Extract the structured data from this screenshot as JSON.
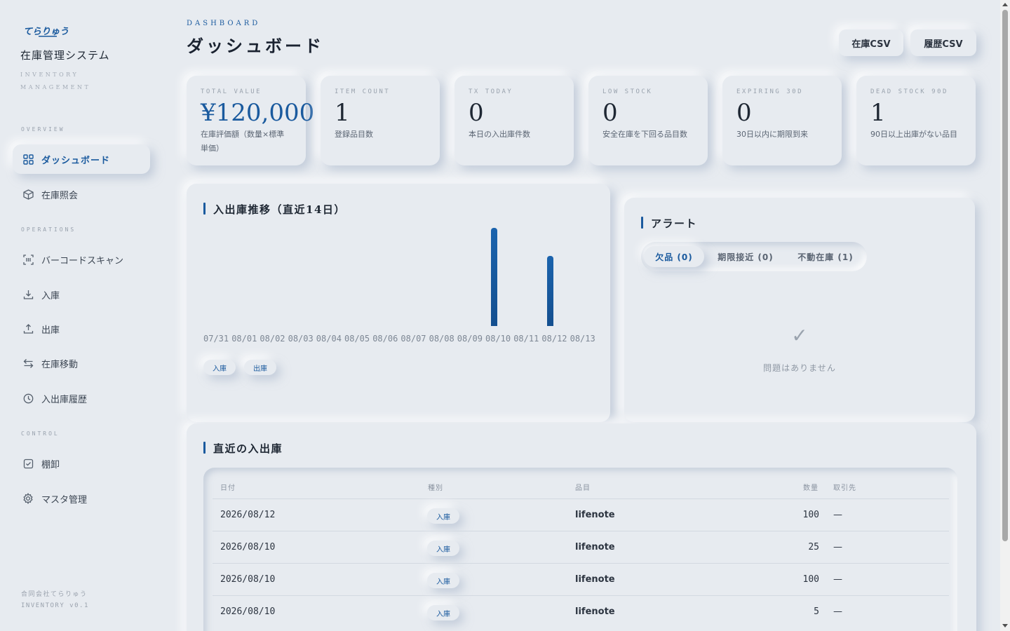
{
  "sidebar": {
    "logo_text": "てらりゅう",
    "app_title": "在庫管理システム",
    "app_subtitle": "INVENTORY MANAGEMENT",
    "sections": {
      "overview": "OVERVIEW",
      "operations": "OPERATIONS",
      "control": "CONTROL"
    },
    "items": [
      {
        "label": "ダッシュボード",
        "icon": "grid-icon",
        "active": true
      },
      {
        "label": "在庫照会",
        "icon": "box-icon"
      },
      {
        "label": "バーコードスキャン",
        "icon": "scan-icon"
      },
      {
        "label": "入庫",
        "icon": "download-icon"
      },
      {
        "label": "出庫",
        "icon": "upload-icon"
      },
      {
        "label": "在庫移動",
        "icon": "transfer-icon"
      },
      {
        "label": "入出庫履歴",
        "icon": "clock-icon"
      },
      {
        "label": "棚卸",
        "icon": "checkbox-icon"
      },
      {
        "label": "マスタ管理",
        "icon": "gear-icon"
      }
    ],
    "footer_company": "合同会社てらりゅう",
    "footer_version": "INVENTORY v0.1"
  },
  "header": {
    "eyebrow": "DASHBOARD",
    "title": "ダッシュボード",
    "btn_stock_csv": "在庫CSV",
    "btn_history_csv": "履歴CSV"
  },
  "kpis": [
    {
      "label": "TOTAL VALUE",
      "value": "¥120,000",
      "desc": "在庫評価額（数量×標準単価）"
    },
    {
      "label": "ITEM COUNT",
      "value": "1",
      "desc": "登録品目数"
    },
    {
      "label": "TX TODAY",
      "value": "0",
      "desc": "本日の入出庫件数"
    },
    {
      "label": "LOW STOCK",
      "value": "0",
      "desc": "安全在庫を下回る品目数"
    },
    {
      "label": "EXPIRING 30D",
      "value": "0",
      "desc": "30日以内に期限到来"
    },
    {
      "label": "DEAD STOCK 90D",
      "value": "1",
      "desc": "90日以上出庫がない品目"
    }
  ],
  "trend": {
    "title": "入出庫推移（直近14日）",
    "legend_in": "入庫",
    "legend_out": "出庫"
  },
  "chart_data": {
    "type": "bar",
    "title": "入出庫推移（直近14日）",
    "categories": [
      "07/31",
      "08/01",
      "08/02",
      "08/03",
      "08/04",
      "08/05",
      "08/06",
      "08/07",
      "08/08",
      "08/09",
      "08/10",
      "08/11",
      "08/12",
      "08/13"
    ],
    "series": [
      {
        "name": "入庫",
        "values": [
          0,
          0,
          0,
          0,
          0,
          0,
          0,
          0,
          0,
          0,
          140,
          0,
          100,
          0
        ]
      },
      {
        "name": "出庫",
        "values": [
          0,
          0,
          0,
          0,
          0,
          0,
          0,
          0,
          0,
          0,
          0,
          0,
          0,
          0
        ]
      }
    ],
    "ylim": [
      0,
      140
    ],
    "grid": false,
    "legend": "bottom-left",
    "colors": {
      "in": "#1a5a9e"
    }
  },
  "alerts": {
    "title": "アラート",
    "tabs": [
      "欠品 (0)",
      "期限接近 (0)",
      "不動在庫 (1)"
    ],
    "check_glyph": "✓",
    "empty_message": "問題はありません"
  },
  "recent": {
    "title": "直近の入出庫",
    "columns": [
      "日付",
      "種別",
      "品目",
      "数量",
      "取引先"
    ],
    "rows": [
      {
        "date": "2026/08/12",
        "type": "入庫",
        "item": "lifenote",
        "qty": "100",
        "partner": "—"
      },
      {
        "date": "2026/08/10",
        "type": "入庫",
        "item": "lifenote",
        "qty": "25",
        "partner": "—"
      },
      {
        "date": "2026/08/10",
        "type": "入庫",
        "item": "lifenote",
        "qty": "100",
        "partner": "—"
      },
      {
        "date": "2026/08/10",
        "type": "入庫",
        "item": "lifenote",
        "qty": "5",
        "partner": "—"
      }
    ]
  },
  "colors": {
    "accent": "#1a5a9e",
    "background": "#e7ebf0"
  }
}
